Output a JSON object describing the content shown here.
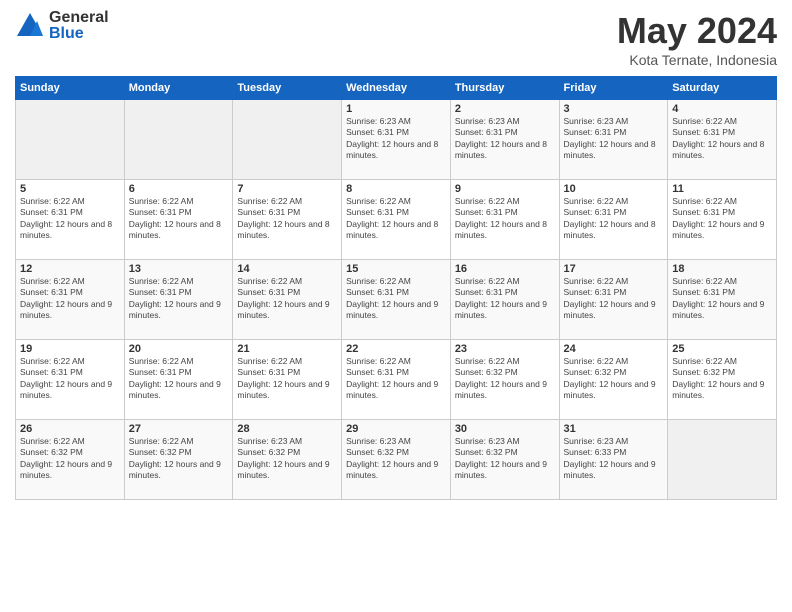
{
  "header": {
    "logo_general": "General",
    "logo_blue": "Blue",
    "month_title": "May 2024",
    "location": "Kota Ternate, Indonesia"
  },
  "weekdays": [
    "Sunday",
    "Monday",
    "Tuesday",
    "Wednesday",
    "Thursday",
    "Friday",
    "Saturday"
  ],
  "weeks": [
    [
      {
        "day": "",
        "info": ""
      },
      {
        "day": "",
        "info": ""
      },
      {
        "day": "",
        "info": ""
      },
      {
        "day": "1",
        "info": "Sunrise: 6:23 AM\nSunset: 6:31 PM\nDaylight: 12 hours and 8 minutes."
      },
      {
        "day": "2",
        "info": "Sunrise: 6:23 AM\nSunset: 6:31 PM\nDaylight: 12 hours and 8 minutes."
      },
      {
        "day": "3",
        "info": "Sunrise: 6:23 AM\nSunset: 6:31 PM\nDaylight: 12 hours and 8 minutes."
      },
      {
        "day": "4",
        "info": "Sunrise: 6:22 AM\nSunset: 6:31 PM\nDaylight: 12 hours and 8 minutes."
      }
    ],
    [
      {
        "day": "5",
        "info": "Sunrise: 6:22 AM\nSunset: 6:31 PM\nDaylight: 12 hours and 8 minutes."
      },
      {
        "day": "6",
        "info": "Sunrise: 6:22 AM\nSunset: 6:31 PM\nDaylight: 12 hours and 8 minutes."
      },
      {
        "day": "7",
        "info": "Sunrise: 6:22 AM\nSunset: 6:31 PM\nDaylight: 12 hours and 8 minutes."
      },
      {
        "day": "8",
        "info": "Sunrise: 6:22 AM\nSunset: 6:31 PM\nDaylight: 12 hours and 8 minutes."
      },
      {
        "day": "9",
        "info": "Sunrise: 6:22 AM\nSunset: 6:31 PM\nDaylight: 12 hours and 8 minutes."
      },
      {
        "day": "10",
        "info": "Sunrise: 6:22 AM\nSunset: 6:31 PM\nDaylight: 12 hours and 8 minutes."
      },
      {
        "day": "11",
        "info": "Sunrise: 6:22 AM\nSunset: 6:31 PM\nDaylight: 12 hours and 9 minutes."
      }
    ],
    [
      {
        "day": "12",
        "info": "Sunrise: 6:22 AM\nSunset: 6:31 PM\nDaylight: 12 hours and 9 minutes."
      },
      {
        "day": "13",
        "info": "Sunrise: 6:22 AM\nSunset: 6:31 PM\nDaylight: 12 hours and 9 minutes."
      },
      {
        "day": "14",
        "info": "Sunrise: 6:22 AM\nSunset: 6:31 PM\nDaylight: 12 hours and 9 minutes."
      },
      {
        "day": "15",
        "info": "Sunrise: 6:22 AM\nSunset: 6:31 PM\nDaylight: 12 hours and 9 minutes."
      },
      {
        "day": "16",
        "info": "Sunrise: 6:22 AM\nSunset: 6:31 PM\nDaylight: 12 hours and 9 minutes."
      },
      {
        "day": "17",
        "info": "Sunrise: 6:22 AM\nSunset: 6:31 PM\nDaylight: 12 hours and 9 minutes."
      },
      {
        "day": "18",
        "info": "Sunrise: 6:22 AM\nSunset: 6:31 PM\nDaylight: 12 hours and 9 minutes."
      }
    ],
    [
      {
        "day": "19",
        "info": "Sunrise: 6:22 AM\nSunset: 6:31 PM\nDaylight: 12 hours and 9 minutes."
      },
      {
        "day": "20",
        "info": "Sunrise: 6:22 AM\nSunset: 6:31 PM\nDaylight: 12 hours and 9 minutes."
      },
      {
        "day": "21",
        "info": "Sunrise: 6:22 AM\nSunset: 6:31 PM\nDaylight: 12 hours and 9 minutes."
      },
      {
        "day": "22",
        "info": "Sunrise: 6:22 AM\nSunset: 6:31 PM\nDaylight: 12 hours and 9 minutes."
      },
      {
        "day": "23",
        "info": "Sunrise: 6:22 AM\nSunset: 6:32 PM\nDaylight: 12 hours and 9 minutes."
      },
      {
        "day": "24",
        "info": "Sunrise: 6:22 AM\nSunset: 6:32 PM\nDaylight: 12 hours and 9 minutes."
      },
      {
        "day": "25",
        "info": "Sunrise: 6:22 AM\nSunset: 6:32 PM\nDaylight: 12 hours and 9 minutes."
      }
    ],
    [
      {
        "day": "26",
        "info": "Sunrise: 6:22 AM\nSunset: 6:32 PM\nDaylight: 12 hours and 9 minutes."
      },
      {
        "day": "27",
        "info": "Sunrise: 6:22 AM\nSunset: 6:32 PM\nDaylight: 12 hours and 9 minutes."
      },
      {
        "day": "28",
        "info": "Sunrise: 6:23 AM\nSunset: 6:32 PM\nDaylight: 12 hours and 9 minutes."
      },
      {
        "day": "29",
        "info": "Sunrise: 6:23 AM\nSunset: 6:32 PM\nDaylight: 12 hours and 9 minutes."
      },
      {
        "day": "30",
        "info": "Sunrise: 6:23 AM\nSunset: 6:32 PM\nDaylight: 12 hours and 9 minutes."
      },
      {
        "day": "31",
        "info": "Sunrise: 6:23 AM\nSunset: 6:33 PM\nDaylight: 12 hours and 9 minutes."
      },
      {
        "day": "",
        "info": ""
      }
    ]
  ]
}
